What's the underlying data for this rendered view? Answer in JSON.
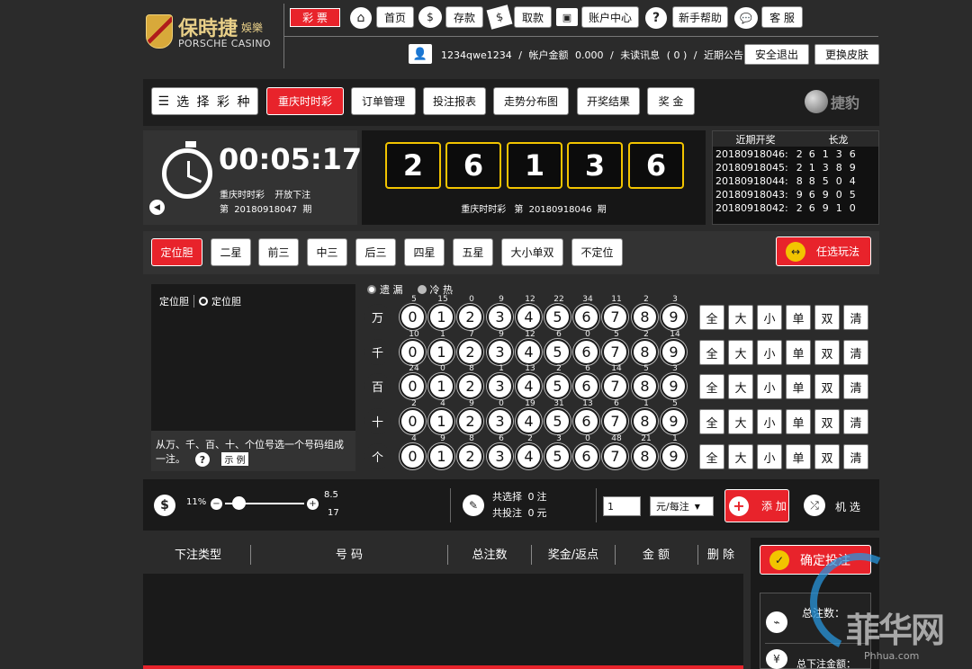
{
  "header": {
    "logo_cn": "保時捷",
    "logo_sub": "娛樂",
    "logo_en": "PORSCHE CASINO",
    "lottery_tab": "彩 票",
    "nav": [
      "首页",
      "存款",
      "取款",
      "账户中心",
      "新手帮助",
      "客 服"
    ],
    "username": "1234qwe1234",
    "balance_label": "帐户金额",
    "balance": "0.000",
    "unread_label": "未读讯息",
    "unread_count": "( 0 )",
    "notice_label": "近期公告",
    "logout": "安全退出",
    "skin": "更换皮肤"
  },
  "toolbar": {
    "choose": "选 择 彩 种",
    "tabs": [
      "重庆时时彩",
      "订单管理",
      "投注报表",
      "走势分布图",
      "开奖结果",
      "奖 金"
    ],
    "brand": "捷豹"
  },
  "timer": {
    "countdown": "00:05:17",
    "game": "重庆时时彩",
    "status": "开放下注",
    "period_prefix": "第",
    "period": "20180918047",
    "period_suffix": "期"
  },
  "draw": {
    "digits": [
      "2",
      "6",
      "1",
      "3",
      "6"
    ],
    "caption_game": "重庆时时彩",
    "caption_prefix": "第",
    "caption_period": "20180918046",
    "caption_suffix": "期"
  },
  "history": {
    "col1": "近期开奖",
    "col2": "长龙",
    "rows": [
      {
        "p": "20180918046:",
        "n": [
          "2",
          "6",
          "1",
          "3",
          "6"
        ]
      },
      {
        "p": "20180918045:",
        "n": [
          "2",
          "1",
          "3",
          "8",
          "9"
        ]
      },
      {
        "p": "20180918044:",
        "n": [
          "8",
          "8",
          "5",
          "0",
          "4"
        ]
      },
      {
        "p": "20180918043:",
        "n": [
          "9",
          "6",
          "9",
          "0",
          "5"
        ]
      },
      {
        "p": "20180918042:",
        "n": [
          "2",
          "6",
          "9",
          "1",
          "0"
        ]
      }
    ]
  },
  "play_tabs": [
    "定位胆",
    "二星",
    "前三",
    "中三",
    "后三",
    "四星",
    "五星",
    "大小单双",
    "不定位"
  ],
  "random_play": "任选玩法",
  "sub": {
    "label": "定位胆",
    "option": "定位胆",
    "desc": "从万、千、百、十、个位号选一个号码组成一注。",
    "example": "示 例"
  },
  "mode": {
    "miss": "遗 漏",
    "hot": "冷 热"
  },
  "positions": [
    {
      "label": "万",
      "miss": [
        "5",
        "15",
        "0",
        "9",
        "12",
        "22",
        "34",
        "11",
        "2",
        "3"
      ]
    },
    {
      "label": "千",
      "miss": [
        "10",
        "1",
        "7",
        "9",
        "12",
        "6",
        "0",
        "5",
        "2",
        "14"
      ]
    },
    {
      "label": "百",
      "miss": [
        "24",
        "0",
        "8",
        "1",
        "13",
        "2",
        "6",
        "14",
        "5",
        "3"
      ]
    },
    {
      "label": "十",
      "miss": [
        "2",
        "4",
        "9",
        "0",
        "19",
        "31",
        "13",
        "6",
        "1",
        "5"
      ]
    },
    {
      "label": "个",
      "miss": [
        "4",
        "9",
        "8",
        "6",
        "2",
        "3",
        "0",
        "48",
        "21",
        "1"
      ]
    }
  ],
  "digits_row": [
    "0",
    "1",
    "2",
    "3",
    "4",
    "5",
    "6",
    "7",
    "8",
    "9"
  ],
  "quick": [
    "全",
    "大",
    "小",
    "单",
    "双",
    "清"
  ],
  "slider": {
    "percent": "11%",
    "odds_top": "8.5",
    "odds_bottom": "17",
    "level": 0.1
  },
  "summary": {
    "select_label": "共选择",
    "select_count": "0",
    "select_unit": "注",
    "bet_label": "共投注",
    "bet_amount": "0",
    "bet_unit": "元"
  },
  "multiplier": "1",
  "unit": "元/每注",
  "add": "添 加",
  "random_pick": "机 选",
  "orders": {
    "headers": [
      "下注类型",
      "号 码",
      "总注数",
      "奖金/返点",
      "金 额",
      "删 除"
    ]
  },
  "confirm": "确定投注",
  "totals": {
    "count_label": "总注数：",
    "amount_label": "总下注金额："
  },
  "watermark": {
    "text": "菲华网",
    "url": "Phhua.com"
  }
}
